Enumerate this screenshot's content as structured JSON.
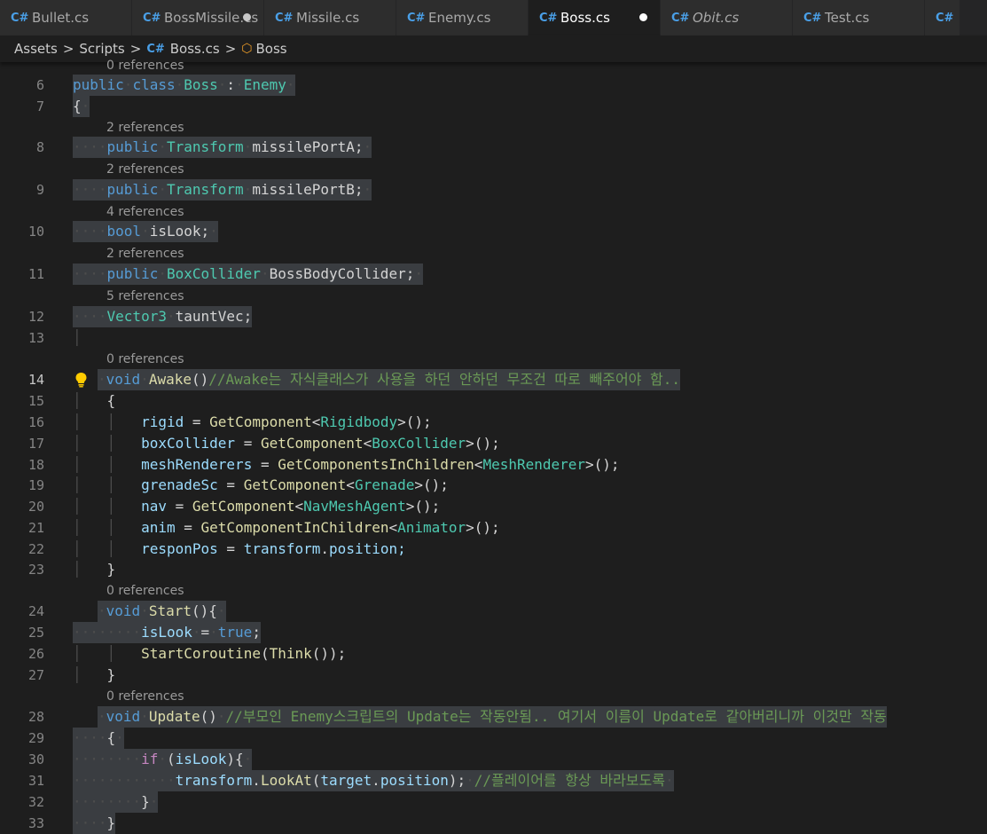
{
  "tabs": [
    {
      "label": "Bullet.cs",
      "dirty": false,
      "active": false,
      "italic": false
    },
    {
      "label": "BossMissile.cs",
      "dirty": true,
      "active": false,
      "italic": false
    },
    {
      "label": "Missile.cs",
      "dirty": false,
      "active": false,
      "italic": false
    },
    {
      "label": "Enemy.cs",
      "dirty": false,
      "active": false,
      "italic": false
    },
    {
      "label": "Boss.cs",
      "dirty": true,
      "active": true,
      "italic": false
    },
    {
      "label": "Obit.cs",
      "dirty": false,
      "active": false,
      "italic": true
    },
    {
      "label": "Test.cs",
      "dirty": false,
      "active": false,
      "italic": false
    }
  ],
  "breadcrumb": {
    "assets": "Assets",
    "scripts": "Scripts",
    "file": "Boss.cs",
    "symbol": "Boss"
  },
  "codelens": {
    "class": "0 references",
    "missilePortA": "2 references",
    "missilePortB": "2 references",
    "isLook": "4 references",
    "bodyCollider": "2 references",
    "tauntVec": "5 references",
    "awake": "0 references",
    "start": "0 references",
    "update": "0 references"
  },
  "lines": {
    "n6": "6",
    "n7": "7",
    "n8": "8",
    "n9": "9",
    "n10": "10",
    "n11": "11",
    "n12": "12",
    "n13": "13",
    "n14": "14",
    "n15": "15",
    "n16": "16",
    "n17": "17",
    "n18": "18",
    "n19": "19",
    "n20": "20",
    "n21": "21",
    "n22": "22",
    "n23": "23",
    "n24": "24",
    "n25": "25",
    "n26": "26",
    "n27": "27",
    "n28": "28",
    "n29": "29",
    "n30": "30",
    "n31": "31",
    "n32": "32",
    "n33": "33"
  },
  "tokens": {
    "public": "public",
    "class": "class",
    "boss": "Boss",
    "colon": ":",
    "enemy": "Enemy",
    "lbrace": "{",
    "rbrace": "}",
    "transform_type": "Transform",
    "missilePortA": "missilePortA;",
    "missilePortB": "missilePortB;",
    "bool": "bool",
    "isLook_decl": "isLook;",
    "boxCollider_type": "BoxCollider",
    "bossBodyCollider": "BossBodyCollider;",
    "vector3": "Vector3",
    "tauntVec": "tauntVec;",
    "void": "void",
    "awake": "Awake",
    "parens": "()",
    "awake_comment": "//Awake는 자식클래스가 사용을 하던 안하던 무조건 따로 빼주어야 함..",
    "rigid": "rigid",
    "boxCollider_var": "boxCollider",
    "meshRenderers": "meshRenderers",
    "grenadeSc": "grenadeSc",
    "nav": "nav",
    "anim": "anim",
    "responPos": "responPos",
    "eq": " = ",
    "getComponent": "GetComponent",
    "getComponentsInChildren": "GetComponentsInChildren",
    "getComponentInChildren": "GetComponentInChildren",
    "lt": "<",
    "gt_call": ">();",
    "rigidbody": "Rigidbody",
    "boxCollider_generic": "BoxCollider",
    "meshRenderer": "MeshRenderer",
    "grenade": "Grenade",
    "navMeshAgent": "NavMeshAgent",
    "animator": "Animator",
    "transform": "transform",
    "position_semi": "position;",
    "dot": ".",
    "start": "Start",
    "parens_brace": "(){",
    "isLook": "isLook",
    "true": "true",
    "semi": ";",
    "startCoroutine": "StartCoroutine",
    "lparen": "(",
    "think": "Think",
    "close_call": "());",
    "update": "Update",
    "update_comment": "//부모인 Enemy스크립트의 Update는 작동안됨.. 여기서 이름이 Update로 같아버리니까 이것만 작동",
    "if": "if",
    "if_cond_open": "(",
    "if_cond_close": "){",
    "lookAt": "LookAt",
    "target": "target",
    "position": "position",
    "close_semi": ");",
    "look_comment": "//플레이어를 항상 바라보도록"
  }
}
